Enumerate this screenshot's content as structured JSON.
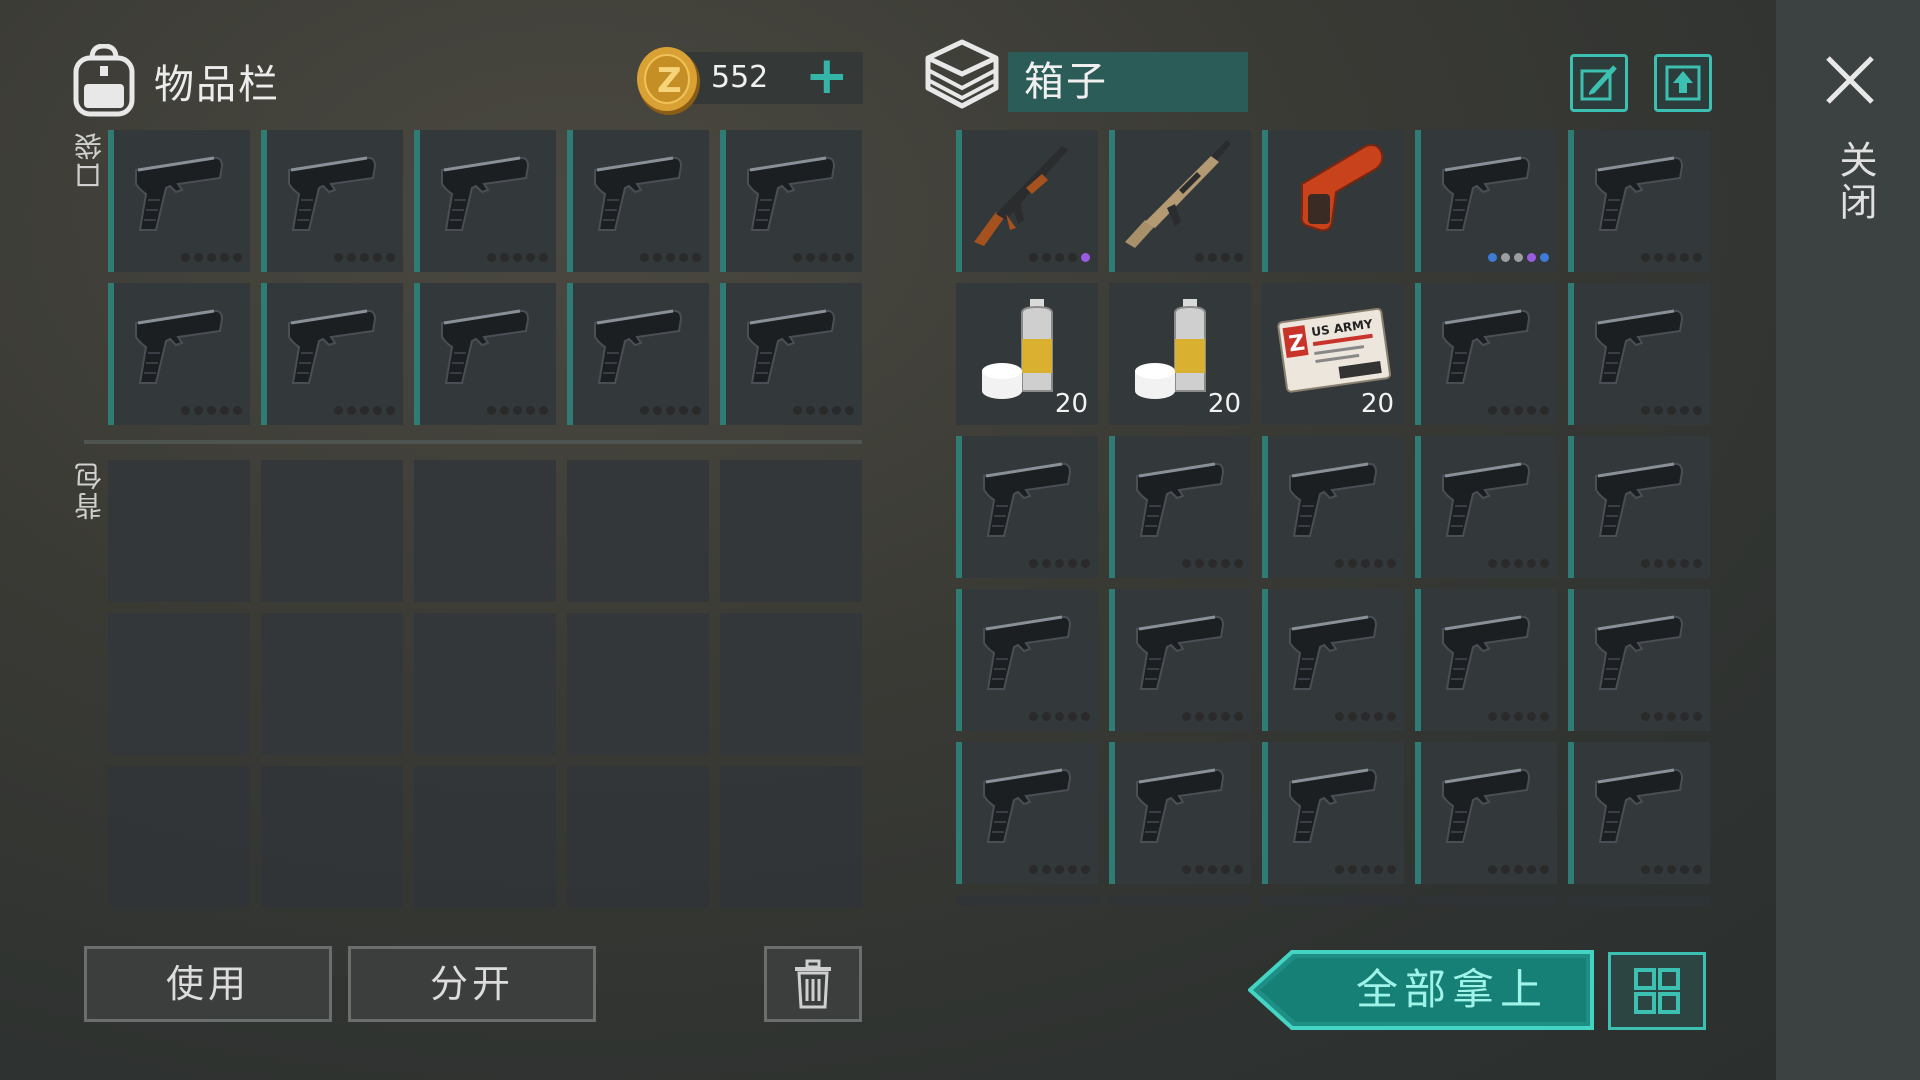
{
  "inventory": {
    "title": "物品栏",
    "coins": "552",
    "add_icon": "plus-icon",
    "pocket_label": "口袋",
    "backpack_label": "背包",
    "pocket_slots": [
      {
        "item": "pistol",
        "dots": [
          "d",
          "d",
          "d",
          "d",
          "d"
        ]
      },
      {
        "item": "pistol",
        "dots": [
          "d",
          "d",
          "d",
          "d",
          "d"
        ]
      },
      {
        "item": "pistol",
        "dots": [
          "d",
          "d",
          "d",
          "d",
          "d"
        ]
      },
      {
        "item": "pistol",
        "dots": [
          "d",
          "d",
          "d",
          "d",
          "d"
        ]
      },
      {
        "item": "pistol",
        "dots": [
          "d",
          "d",
          "d",
          "d",
          "d"
        ]
      },
      {
        "item": "pistol",
        "dots": [
          "d",
          "d",
          "d",
          "d",
          "d"
        ]
      },
      {
        "item": "pistol",
        "dots": [
          "d",
          "d",
          "d",
          "d",
          "d"
        ]
      },
      {
        "item": "pistol",
        "dots": [
          "d",
          "d",
          "d",
          "d",
          "d"
        ]
      },
      {
        "item": "pistol",
        "dots": [
          "d",
          "d",
          "d",
          "d",
          "d"
        ]
      },
      {
        "item": "pistol",
        "dots": [
          "d",
          "d",
          "d",
          "d",
          "d"
        ]
      }
    ],
    "backpack_slots": 15
  },
  "box": {
    "title": "箱子",
    "close_label": "关闭",
    "slots": [
      {
        "item": "ak",
        "dots": [
          "d",
          "d",
          "d",
          "d",
          "pu"
        ]
      },
      {
        "item": "rifle",
        "dots": [
          "d",
          "d",
          "d",
          "d"
        ]
      },
      {
        "item": "flaregun",
        "dots": []
      },
      {
        "item": "pistol",
        "dots": [
          "bl",
          "lt",
          "lt",
          "pu",
          "bl"
        ]
      },
      {
        "item": "pistol",
        "dots": [
          "d",
          "d",
          "d",
          "d",
          "d"
        ]
      },
      {
        "item": "paint",
        "qty": "20",
        "dots": []
      },
      {
        "item": "paint",
        "qty": "20",
        "dots": []
      },
      {
        "item": "card",
        "qty": "20",
        "dots": []
      },
      {
        "item": "pistol",
        "dots": [
          "d",
          "d",
          "d",
          "d",
          "d"
        ]
      },
      {
        "item": "pistol",
        "dots": [
          "d",
          "d",
          "d",
          "d",
          "d"
        ]
      },
      {
        "item": "pistol",
        "dots": [
          "d",
          "d",
          "d",
          "d",
          "d"
        ]
      },
      {
        "item": "pistol",
        "dots": [
          "d",
          "d",
          "d",
          "d",
          "d"
        ]
      },
      {
        "item": "pistol",
        "dots": [
          "d",
          "d",
          "d",
          "d",
          "d"
        ]
      },
      {
        "item": "pistol",
        "dots": [
          "d",
          "d",
          "d",
          "d",
          "d"
        ]
      },
      {
        "item": "pistol",
        "dots": [
          "d",
          "d",
          "d",
          "d",
          "d"
        ]
      },
      {
        "item": "pistol",
        "dots": [
          "d",
          "d",
          "d",
          "d",
          "d"
        ]
      },
      {
        "item": "pistol",
        "dots": [
          "d",
          "d",
          "d",
          "d",
          "d"
        ]
      },
      {
        "item": "pistol",
        "dots": [
          "d",
          "d",
          "d",
          "d",
          "d"
        ]
      },
      {
        "item": "pistol",
        "dots": [
          "d",
          "d",
          "d",
          "d",
          "d"
        ]
      },
      {
        "item": "pistol",
        "dots": [
          "d",
          "d",
          "d",
          "d",
          "d"
        ]
      },
      {
        "item": "pistol",
        "dots": [
          "d",
          "d",
          "d",
          "d",
          "d"
        ]
      },
      {
        "item": "pistol",
        "dots": [
          "d",
          "d",
          "d",
          "d",
          "d"
        ]
      },
      {
        "item": "pistol",
        "dots": [
          "d",
          "d",
          "d",
          "d",
          "d"
        ]
      },
      {
        "item": "pistol",
        "dots": [
          "d",
          "d",
          "d",
          "d",
          "d"
        ]
      },
      {
        "item": "pistol",
        "dots": [
          "d",
          "d",
          "d",
          "d",
          "d"
        ]
      }
    ],
    "card_text": "US ARMY"
  },
  "buttons": {
    "use": "使用",
    "split": "分开",
    "take_all": "全部拿上"
  },
  "colors": {
    "accent": "#3cc0b2",
    "slot_teal": "#2f7c74",
    "coin": "#d9a134"
  }
}
